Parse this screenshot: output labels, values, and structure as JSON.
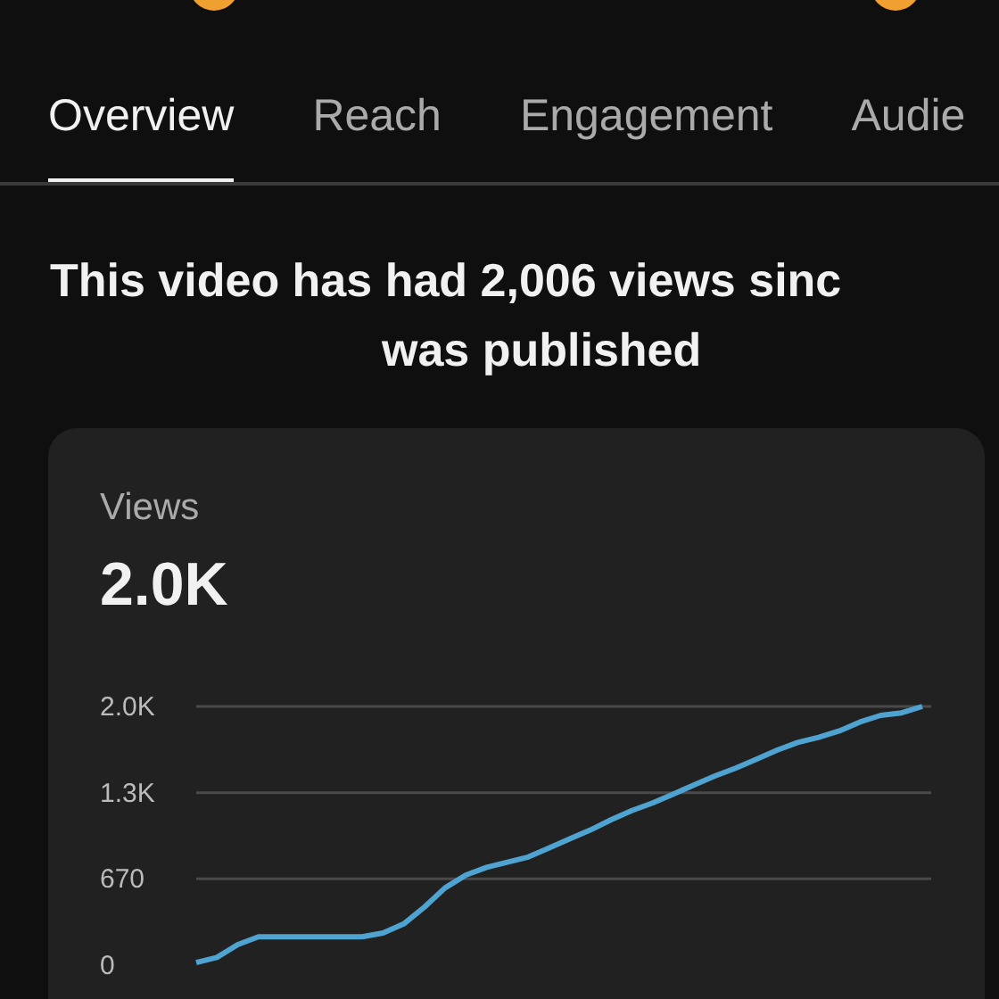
{
  "tabs": [
    {
      "label": "Overview",
      "selected": true
    },
    {
      "label": "Reach",
      "selected": false
    },
    {
      "label": "Engagement",
      "selected": false
    },
    {
      "label": "Audie",
      "selected": false
    }
  ],
  "headline_lines": [
    "This video has had 2,006 views sinc",
    "was published"
  ],
  "card": {
    "title": "Views",
    "total": "2.0K",
    "chart_data": {
      "type": "line",
      "yticks": [
        {
          "value": 0,
          "label": "0"
        },
        {
          "value": 670,
          "label": "670"
        },
        {
          "value": 1340,
          "label": "1.3K"
        },
        {
          "value": 2010,
          "label": "2.0K"
        }
      ],
      "ylim": [
        0,
        2010
      ],
      "series": [
        {
          "color": "#4fa3d1",
          "values": [
            20,
            60,
            160,
            220,
            220,
            220,
            220,
            220,
            220,
            250,
            320,
            450,
            600,
            700,
            760,
            800,
            840,
            910,
            980,
            1050,
            1130,
            1200,
            1260,
            1330,
            1400,
            1470,
            1530,
            1600,
            1670,
            1730,
            1770,
            1820,
            1890,
            1940,
            1960,
            2010
          ]
        }
      ]
    }
  }
}
